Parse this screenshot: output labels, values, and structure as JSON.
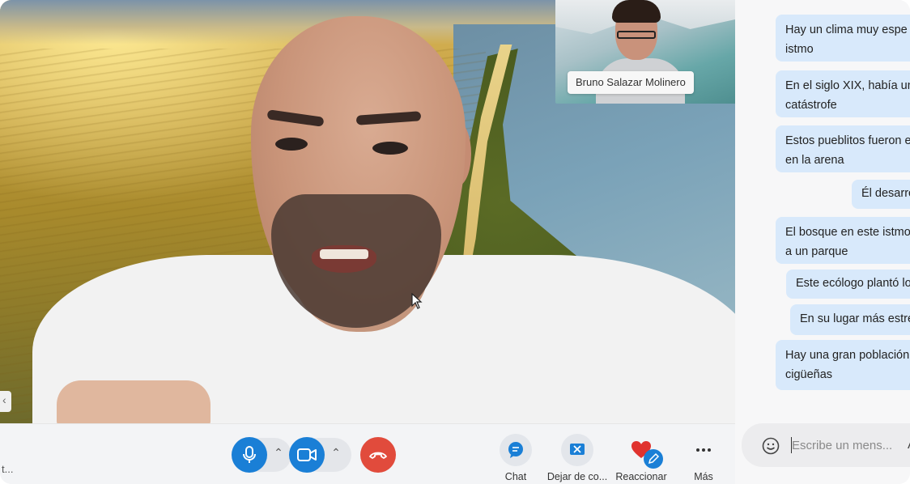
{
  "remote_participant": {
    "name": "Bruno Salazar Molinero"
  },
  "controls": {
    "mic_icon": "microphone-icon",
    "camera_icon": "video-camera-icon",
    "end_call_icon": "hang-up-icon",
    "chat_label": "Chat",
    "leave_label": "Dejar de co...",
    "react_label": "Reaccionar",
    "more_label": "Más"
  },
  "bottom_left_text": "t...",
  "chat": {
    "messages": [
      "Hay un clima muy espe",
      "istmo",
      "En el siglo XIX, había un",
      "catástrofe",
      "Estos pueblitos fueron e",
      "en la arena",
      "Él desarro",
      "El bosque en este istmo",
      "a un parque",
      "Este ecólogo plantó lo",
      "En su lugar más estre",
      "Hay una gran población",
      "cigüeñas"
    ],
    "composer_placeholder": "Escribe un mens..."
  },
  "colors": {
    "accent": "#1a7fd6",
    "end_call": "#e14b3c",
    "bubble": "#d8e9fb",
    "heart": "#e0332f"
  }
}
